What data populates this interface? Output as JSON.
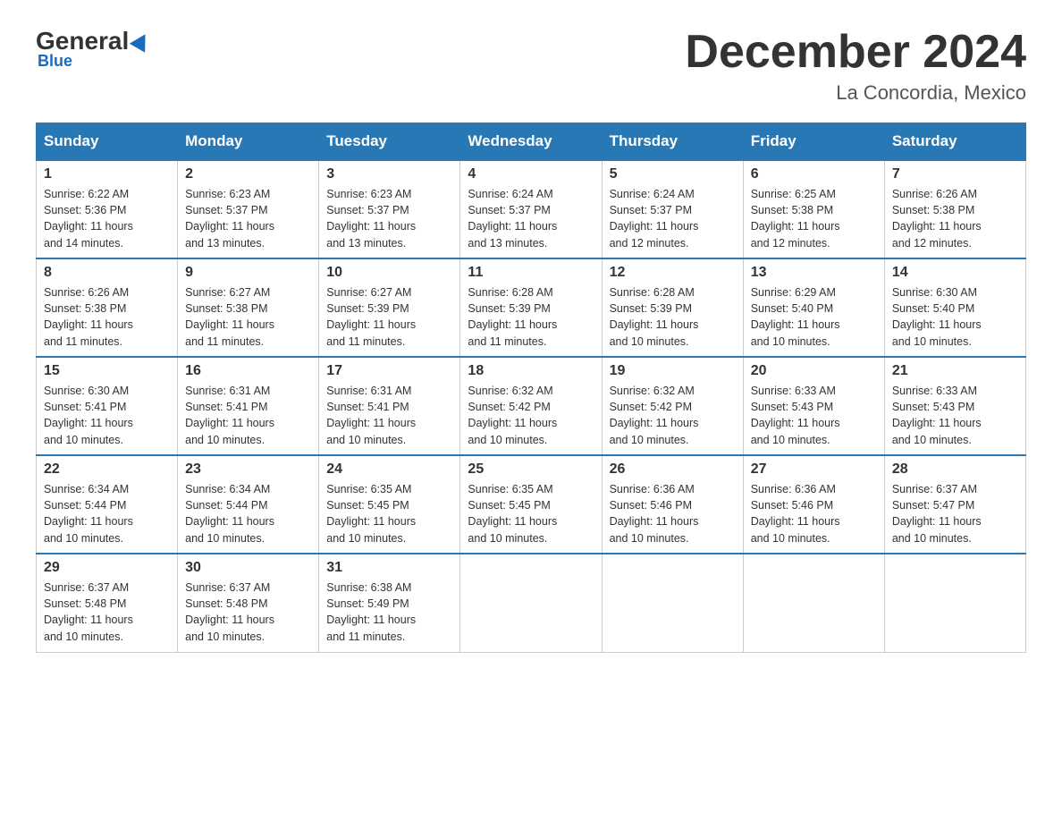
{
  "header": {
    "logo_general": "General",
    "logo_blue": "Blue",
    "title": "December 2024",
    "subtitle": "La Concordia, Mexico"
  },
  "days_of_week": [
    "Sunday",
    "Monday",
    "Tuesday",
    "Wednesday",
    "Thursday",
    "Friday",
    "Saturday"
  ],
  "weeks": [
    [
      {
        "num": "1",
        "sunrise": "6:22 AM",
        "sunset": "5:36 PM",
        "daylight": "11 hours and 14 minutes."
      },
      {
        "num": "2",
        "sunrise": "6:23 AM",
        "sunset": "5:37 PM",
        "daylight": "11 hours and 13 minutes."
      },
      {
        "num": "3",
        "sunrise": "6:23 AM",
        "sunset": "5:37 PM",
        "daylight": "11 hours and 13 minutes."
      },
      {
        "num": "4",
        "sunrise": "6:24 AM",
        "sunset": "5:37 PM",
        "daylight": "11 hours and 13 minutes."
      },
      {
        "num": "5",
        "sunrise": "6:24 AM",
        "sunset": "5:37 PM",
        "daylight": "11 hours and 12 minutes."
      },
      {
        "num": "6",
        "sunrise": "6:25 AM",
        "sunset": "5:38 PM",
        "daylight": "11 hours and 12 minutes."
      },
      {
        "num": "7",
        "sunrise": "6:26 AM",
        "sunset": "5:38 PM",
        "daylight": "11 hours and 12 minutes."
      }
    ],
    [
      {
        "num": "8",
        "sunrise": "6:26 AM",
        "sunset": "5:38 PM",
        "daylight": "11 hours and 11 minutes."
      },
      {
        "num": "9",
        "sunrise": "6:27 AM",
        "sunset": "5:38 PM",
        "daylight": "11 hours and 11 minutes."
      },
      {
        "num": "10",
        "sunrise": "6:27 AM",
        "sunset": "5:39 PM",
        "daylight": "11 hours and 11 minutes."
      },
      {
        "num": "11",
        "sunrise": "6:28 AM",
        "sunset": "5:39 PM",
        "daylight": "11 hours and 11 minutes."
      },
      {
        "num": "12",
        "sunrise": "6:28 AM",
        "sunset": "5:39 PM",
        "daylight": "11 hours and 10 minutes."
      },
      {
        "num": "13",
        "sunrise": "6:29 AM",
        "sunset": "5:40 PM",
        "daylight": "11 hours and 10 minutes."
      },
      {
        "num": "14",
        "sunrise": "6:30 AM",
        "sunset": "5:40 PM",
        "daylight": "11 hours and 10 minutes."
      }
    ],
    [
      {
        "num": "15",
        "sunrise": "6:30 AM",
        "sunset": "5:41 PM",
        "daylight": "11 hours and 10 minutes."
      },
      {
        "num": "16",
        "sunrise": "6:31 AM",
        "sunset": "5:41 PM",
        "daylight": "11 hours and 10 minutes."
      },
      {
        "num": "17",
        "sunrise": "6:31 AM",
        "sunset": "5:41 PM",
        "daylight": "11 hours and 10 minutes."
      },
      {
        "num": "18",
        "sunrise": "6:32 AM",
        "sunset": "5:42 PM",
        "daylight": "11 hours and 10 minutes."
      },
      {
        "num": "19",
        "sunrise": "6:32 AM",
        "sunset": "5:42 PM",
        "daylight": "11 hours and 10 minutes."
      },
      {
        "num": "20",
        "sunrise": "6:33 AM",
        "sunset": "5:43 PM",
        "daylight": "11 hours and 10 minutes."
      },
      {
        "num": "21",
        "sunrise": "6:33 AM",
        "sunset": "5:43 PM",
        "daylight": "11 hours and 10 minutes."
      }
    ],
    [
      {
        "num": "22",
        "sunrise": "6:34 AM",
        "sunset": "5:44 PM",
        "daylight": "11 hours and 10 minutes."
      },
      {
        "num": "23",
        "sunrise": "6:34 AM",
        "sunset": "5:44 PM",
        "daylight": "11 hours and 10 minutes."
      },
      {
        "num": "24",
        "sunrise": "6:35 AM",
        "sunset": "5:45 PM",
        "daylight": "11 hours and 10 minutes."
      },
      {
        "num": "25",
        "sunrise": "6:35 AM",
        "sunset": "5:45 PM",
        "daylight": "11 hours and 10 minutes."
      },
      {
        "num": "26",
        "sunrise": "6:36 AM",
        "sunset": "5:46 PM",
        "daylight": "11 hours and 10 minutes."
      },
      {
        "num": "27",
        "sunrise": "6:36 AM",
        "sunset": "5:46 PM",
        "daylight": "11 hours and 10 minutes."
      },
      {
        "num": "28",
        "sunrise": "6:37 AM",
        "sunset": "5:47 PM",
        "daylight": "11 hours and 10 minutes."
      }
    ],
    [
      {
        "num": "29",
        "sunrise": "6:37 AM",
        "sunset": "5:48 PM",
        "daylight": "11 hours and 10 minutes."
      },
      {
        "num": "30",
        "sunrise": "6:37 AM",
        "sunset": "5:48 PM",
        "daylight": "11 hours and 10 minutes."
      },
      {
        "num": "31",
        "sunrise": "6:38 AM",
        "sunset": "5:49 PM",
        "daylight": "11 hours and 11 minutes."
      },
      null,
      null,
      null,
      null
    ]
  ],
  "labels": {
    "sunrise_prefix": "Sunrise: ",
    "sunset_prefix": "Sunset: ",
    "daylight_prefix": "Daylight: "
  }
}
